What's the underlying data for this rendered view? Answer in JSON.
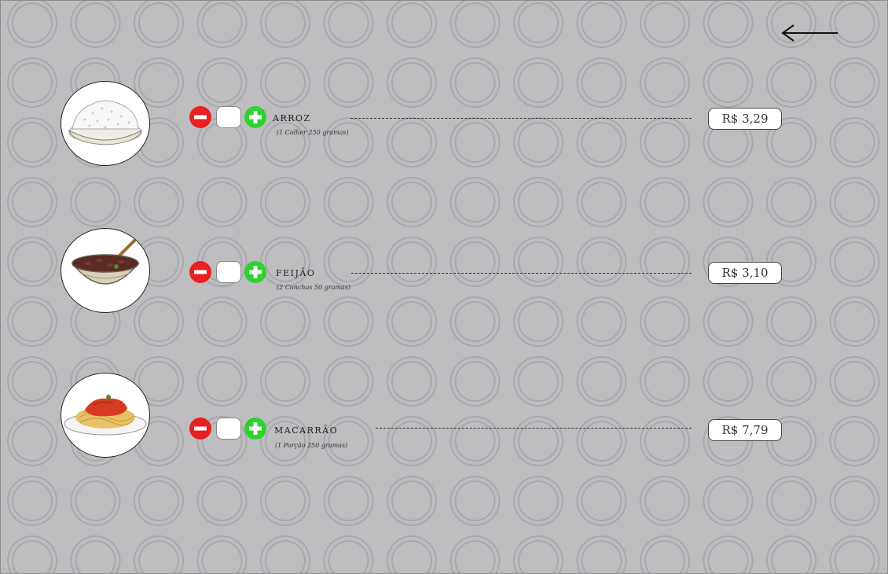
{
  "nav": {
    "back_icon": "left-arrow-icon"
  },
  "items": [
    {
      "name": "ARROZ",
      "description": "(1 Colher 250 gramas)",
      "quantity": "",
      "price": "R$  3,29",
      "image_icon": "rice-bowl-icon"
    },
    {
      "name": "FEIJÃO",
      "description": "(2 Conchas 50 gramas)",
      "quantity": "",
      "price": "R$  3,10",
      "image_icon": "beans-bowl-icon"
    },
    {
      "name": "MACARRÃO",
      "description": "(1 Porção 250 gramas)",
      "quantity": "",
      "price": "R$  7,79",
      "image_icon": "spaghetti-plate-icon"
    }
  ],
  "colors": {
    "minus": "#e82020",
    "plus": "#2ed22e",
    "background": "#bdbdc0"
  }
}
